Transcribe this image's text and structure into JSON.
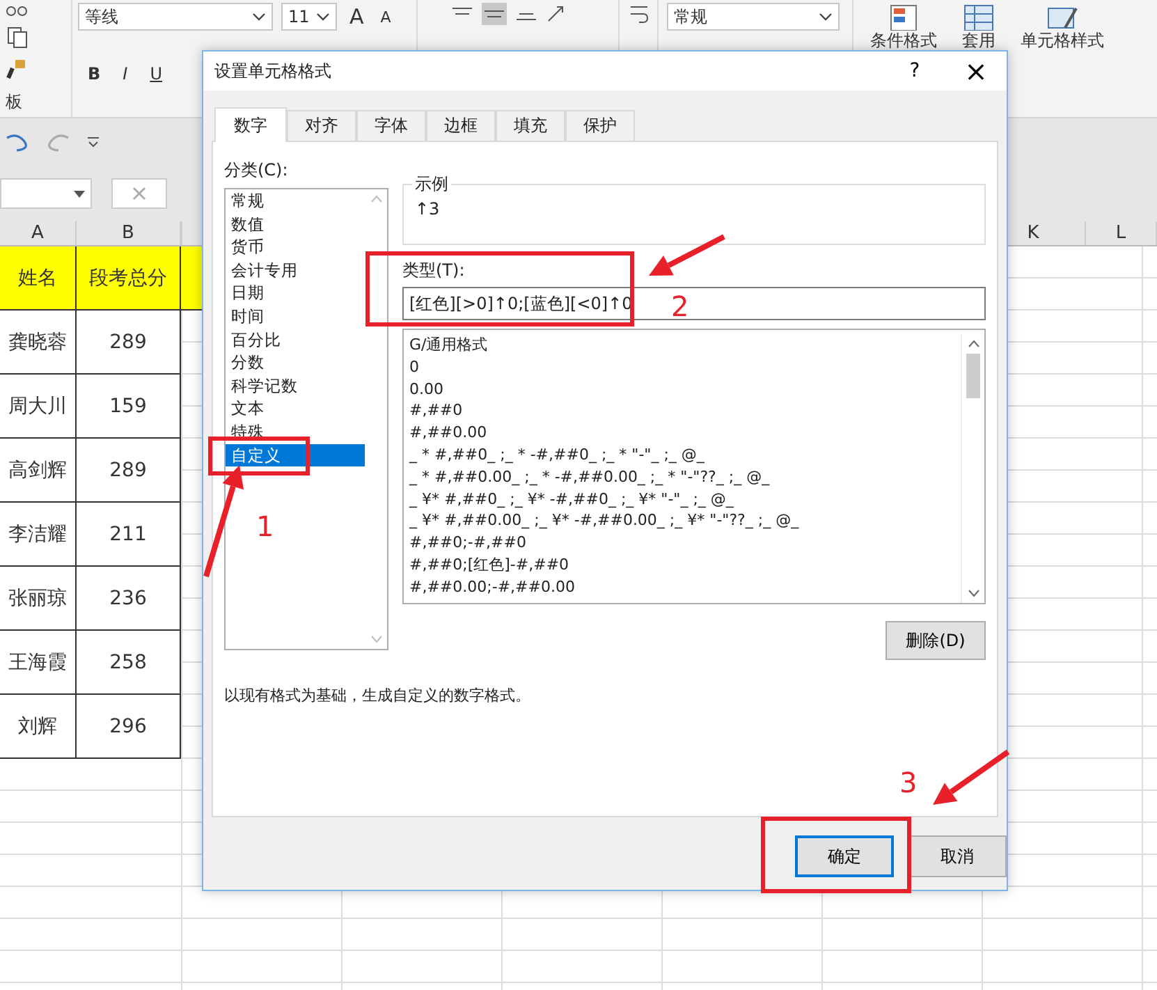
{
  "ribbon": {
    "font_name": "等线",
    "font_size": "11",
    "grow_font": "A",
    "shrink_font": "A",
    "bold": "B",
    "italic": "I",
    "underline": "U",
    "clipboard_label": "板",
    "number_format": "常规",
    "conditional_format": "条件格式",
    "table_format": "套用",
    "cell_styles": "单元格样式"
  },
  "sheet": {
    "columns": [
      "A",
      "B",
      "K",
      "L"
    ],
    "header": [
      "姓名",
      "段考总分"
    ],
    "rows": [
      [
        "龚晓蓉",
        "289"
      ],
      [
        "周大川",
        "159"
      ],
      [
        "高剑辉",
        "289"
      ],
      [
        "李洁耀",
        "211"
      ],
      [
        "张丽琼",
        "236"
      ],
      [
        "王海霞",
        "258"
      ],
      [
        "刘辉",
        "296"
      ]
    ]
  },
  "dialog": {
    "title": "设置单元格格式",
    "help": "?",
    "close": "×",
    "tabs": [
      {
        "label": "数字",
        "selected": true
      },
      {
        "label": "对齐",
        "selected": false
      },
      {
        "label": "字体",
        "selected": false
      },
      {
        "label": "边框",
        "selected": false
      },
      {
        "label": "填充",
        "selected": false
      },
      {
        "label": "保护",
        "selected": false
      }
    ],
    "category_label": "分类(C):",
    "categories": [
      {
        "label": "常规",
        "selected": false
      },
      {
        "label": "数值",
        "selected": false
      },
      {
        "label": "货币",
        "selected": false
      },
      {
        "label": "会计专用",
        "selected": false
      },
      {
        "label": "日期",
        "selected": false
      },
      {
        "label": "时间",
        "selected": false
      },
      {
        "label": "百分比",
        "selected": false
      },
      {
        "label": "分数",
        "selected": false
      },
      {
        "label": "科学记数",
        "selected": false
      },
      {
        "label": "文本",
        "selected": false
      },
      {
        "label": "特殊",
        "selected": false
      },
      {
        "label": "自定义",
        "selected": true
      }
    ],
    "sample_label": "示例",
    "sample_value": "↑3",
    "type_label": "类型(T):",
    "type_value": "[红色][>0]↑0;[蓝色][<0]↑0",
    "formats": [
      {
        "label": "G/通用格式",
        "selected": false
      },
      {
        "label": "0",
        "selected": false
      },
      {
        "label": "0.00",
        "selected": false
      },
      {
        "label": "#,##0",
        "selected": false
      },
      {
        "label": "#,##0.00",
        "selected": false
      },
      {
        "label": "_ * #,##0_ ;_ * -#,##0_ ;_ * \"-\"_ ;_ @_",
        "selected": false
      },
      {
        "label": "_ * #,##0.00_ ;_ * -#,##0.00_ ;_ * \"-\"??_ ;_ @_",
        "selected": false
      },
      {
        "label": "_ ¥* #,##0_ ;_ ¥* -#,##0_ ;_ ¥* \"-\"_ ;_ @_",
        "selected": false
      },
      {
        "label": "_ ¥* #,##0.00_ ;_ ¥* -#,##0.00_ ;_ ¥* \"-\"??_ ;_ @_",
        "selected": false
      },
      {
        "label": "#,##0;-#,##0",
        "selected": false
      },
      {
        "label": "#,##0;[红色]-#,##0",
        "selected": false
      },
      {
        "label": "#,##0.00;-#,##0.00",
        "selected": false
      }
    ],
    "delete_button": "删除(D)",
    "description": "以现有格式为基础，生成自定义的数字格式。",
    "ok_button": "确定",
    "cancel_button": "取消"
  },
  "annotations": [
    {
      "number": "1"
    },
    {
      "number": "2"
    },
    {
      "number": "3"
    }
  ]
}
